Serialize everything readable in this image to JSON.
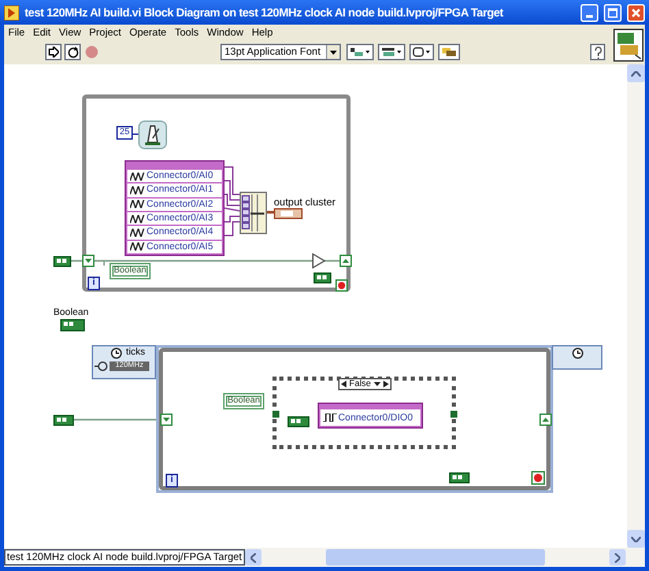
{
  "window": {
    "title": "test 120MHz AI build.vi Block Diagram on test 120MHz clock AI node build.lvproj/FPGA Target"
  },
  "menu": [
    "File",
    "Edit",
    "View",
    "Project",
    "Operate",
    "Tools",
    "Window",
    "Help"
  ],
  "toolbar": {
    "font": "13pt Application Font"
  },
  "diagram": {
    "while_loop": {
      "wait_constant": "25",
      "io_channels": [
        "Connector0/AI0",
        "Connector0/AI1",
        "Connector0/AI2",
        "Connector0/AI3",
        "Connector0/AI4",
        "Connector0/AI5"
      ],
      "bundle_label": "output cluster",
      "control_label": "Boolean",
      "iteration": "i"
    },
    "boolean_label": "Boolean",
    "timed_loop": {
      "output_label": "ticks",
      "clock": "120MHz",
      "case_selector": "False",
      "control_label": "Boolean",
      "io_channel": "Connector0/DIO0",
      "iteration": "i"
    }
  },
  "status_bar": "test 120MHz clock AI node build.lvproj/FPGA Target"
}
